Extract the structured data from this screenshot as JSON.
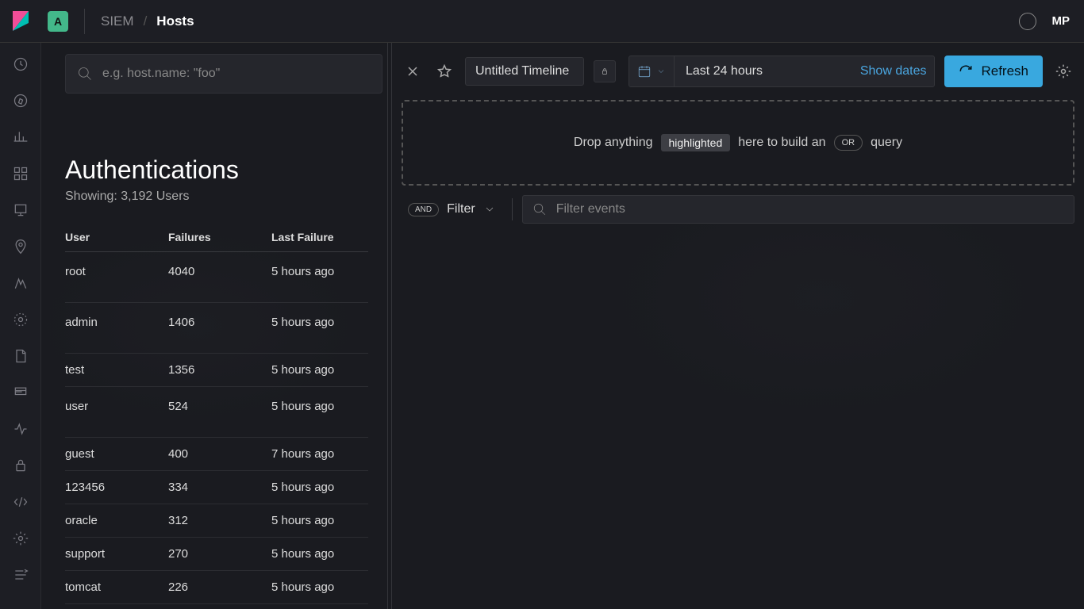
{
  "header": {
    "space_letter": "A",
    "crumb1": "SIEM",
    "crumb2": "Hosts",
    "user_initials": "MP"
  },
  "left": {
    "search_placeholder": "e.g. host.name: \"foo\"",
    "panel_title": "Authentications",
    "panel_sub": "Showing: 3,192 Users",
    "columns": {
      "user": "User",
      "failures": "Failures",
      "last_failure": "Last Failure"
    },
    "rows": [
      {
        "user": "root",
        "failures": "4040",
        "last": "5 hours ago",
        "tall": true
      },
      {
        "user": "admin",
        "failures": "1406",
        "last": "5 hours ago",
        "tall": true
      },
      {
        "user": "test",
        "failures": "1356",
        "last": "5 hours ago"
      },
      {
        "user": "user",
        "failures": "524",
        "last": "5 hours ago",
        "tall": true
      },
      {
        "user": "guest",
        "failures": "400",
        "last": "7 hours ago"
      },
      {
        "user": "123456",
        "failures": "334",
        "last": "5 hours ago"
      },
      {
        "user": "oracle",
        "failures": "312",
        "last": "5 hours ago"
      },
      {
        "user": "support",
        "failures": "270",
        "last": "5 hours ago"
      },
      {
        "user": "tomcat",
        "failures": "226",
        "last": "5 hours ago"
      }
    ]
  },
  "timeline": {
    "title": "Untitled Timeline",
    "date_range": "Last 24 hours",
    "show_dates": "Show dates",
    "refresh": "Refresh",
    "drop_pre": "Drop anything",
    "drop_hl": "highlighted",
    "drop_mid": "here to build an",
    "drop_or": "OR",
    "drop_post": "query",
    "and_label": "AND",
    "filter_label": "Filter",
    "filter_events_ph": "Filter events"
  }
}
